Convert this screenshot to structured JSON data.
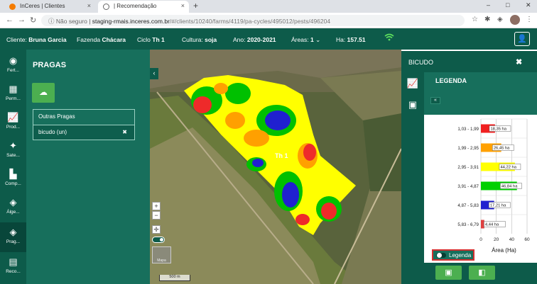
{
  "browser": {
    "tabs": [
      {
        "title": "InCeres | Clientes",
        "close": "×"
      },
      {
        "title": "| Recomendação",
        "close": "×"
      }
    ],
    "new_tab": "+",
    "window_controls": {
      "minimize": "–",
      "maximize": "□",
      "close": "✕"
    },
    "security": "Não seguro",
    "url_host": "staging-rmais.inceres.com.br",
    "url_path": "/#/clients/10240/farms/4119/pa-cycles/495012/pests/496204"
  },
  "header": {
    "client_label": "Cliente:",
    "client": "Bruna Garcia",
    "farm_label": "Fazenda",
    "farm": "Chácara",
    "cycle_label": "Ciclo",
    "cycle": "Th 1",
    "crop_label": "Cultura:",
    "crop": "soja",
    "year_label": "Ano:",
    "year": "2020-2021",
    "areas_label": "Áreas:",
    "areas": "1",
    "ha_label": "Ha:",
    "ha": "157.51"
  },
  "sidebar": {
    "items": [
      {
        "label": "Fert...",
        "icon": "fertility-icon"
      },
      {
        "label": "Perm...",
        "icon": "permission-icon"
      },
      {
        "label": "Prod...",
        "icon": "productivity-icon"
      },
      {
        "label": "Sate...",
        "icon": "satellite-icon"
      },
      {
        "label": "Comp...",
        "icon": "compaction-icon"
      },
      {
        "label": "Álge...",
        "icon": "algebra-icon"
      },
      {
        "label": "Prag...",
        "icon": "pests-icon"
      },
      {
        "label": "Reco...",
        "icon": "recommendation-icon"
      }
    ]
  },
  "pests_panel": {
    "title": "PRAGAS",
    "items": [
      {
        "label": "Outras Pragas"
      },
      {
        "label": "bicudo (un)",
        "delete": "✖"
      }
    ]
  },
  "map": {
    "field_label": "Th 1",
    "zoom_in": "+",
    "zoom_out": "−",
    "thumb_label": "Mapa",
    "scale_label": "500 m"
  },
  "right_panel": {
    "title": "BICUDO",
    "close": "✖",
    "legend_title": "LEGENDA",
    "back": "«",
    "legend_toggle": "Legenda"
  },
  "colors": {
    "header_bg": "#0d5b4a",
    "panel_bg": "#176f5c",
    "accent_green": "#4caf50",
    "class_colors": [
      "#f02020",
      "#ffa000",
      "#ffff00",
      "#00d000",
      "#2020d0",
      "#e04040"
    ]
  },
  "chart_data": {
    "type": "bar",
    "orientation": "horizontal",
    "categories": [
      "1,03 - 1,99",
      "1,99 - 2,95",
      "2,95 - 3,91",
      "3,91 - 4,87",
      "4,87 - 5,83",
      "5,83 - 6,79"
    ],
    "values": [
      18.35,
      26.45,
      44.22,
      46.84,
      17.21,
      4.44
    ],
    "value_labels": [
      "18,35 ha",
      "26,45 ha",
      "44,22 ha",
      "46,84 ha",
      "17,21 ha",
      "4,44 ha"
    ],
    "colors": [
      "#f02020",
      "#ffa000",
      "#ffff00",
      "#00d000",
      "#2020d0",
      "#e04040"
    ],
    "xlabel": "Área (Ha)",
    "xlim": [
      0,
      60
    ],
    "xticks": [
      "0",
      "20",
      "40",
      "60"
    ],
    "grid": true
  }
}
